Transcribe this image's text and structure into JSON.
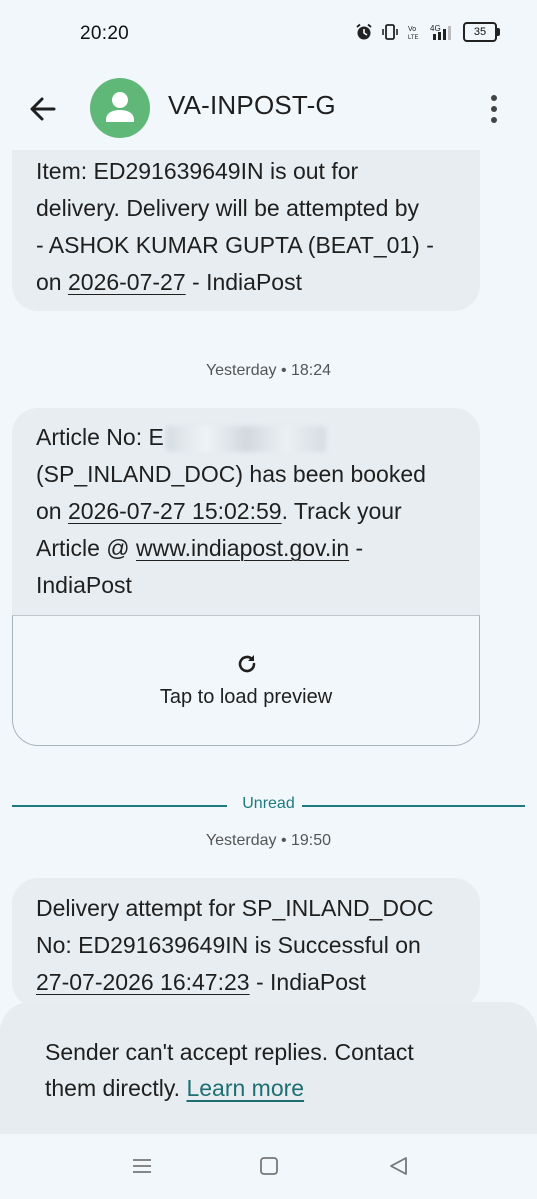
{
  "status_bar": {
    "time": "20:20",
    "battery": "35"
  },
  "header": {
    "title": "VA-INPOST-G"
  },
  "messages": [
    {
      "lines": [
        "Item: ED291639649IN is out for",
        "delivery. Delivery will be attempted by",
        "- ASHOK KUMAR GUPTA (BEAT_01) -"
      ],
      "line4_prefix": "on ",
      "line4_link": "2026-07-27",
      "line4_suffix": " - IndiaPost"
    },
    {
      "timestamp": "Yesterday • 18:24",
      "line1_prefix": "Article No: E",
      "line2": "(SP_INLAND_DOC) has been booked",
      "line3_prefix": "on ",
      "line3_link": "2026-07-27 15:02:59",
      "line3_suffix": ". Track your",
      "line4_prefix": "Article @ ",
      "line4_link": "www.indiapost.gov.in",
      "line4_suffix": " -",
      "line5": "IndiaPost",
      "preview_label": "Tap to load preview"
    },
    {
      "timestamp": "Yesterday • 19:50",
      "line1": "Delivery attempt for SP_INLAND_DOC",
      "line2": "No: ED291639649IN is Successful on",
      "line3_link": "27-07-2026 16:47:23",
      "line3_suffix": " - IndiaPost"
    }
  ],
  "unread_label": "Unread",
  "footer": {
    "note_line1": "Sender can't accept replies. Contact",
    "note_line2_prefix": "them directly. ",
    "learn_more": "Learn more"
  },
  "colors": {
    "avatar": "#5fb878",
    "accent": "#1e7a7e",
    "bubble": "#e7edf1",
    "background": "#f1f7fb"
  }
}
